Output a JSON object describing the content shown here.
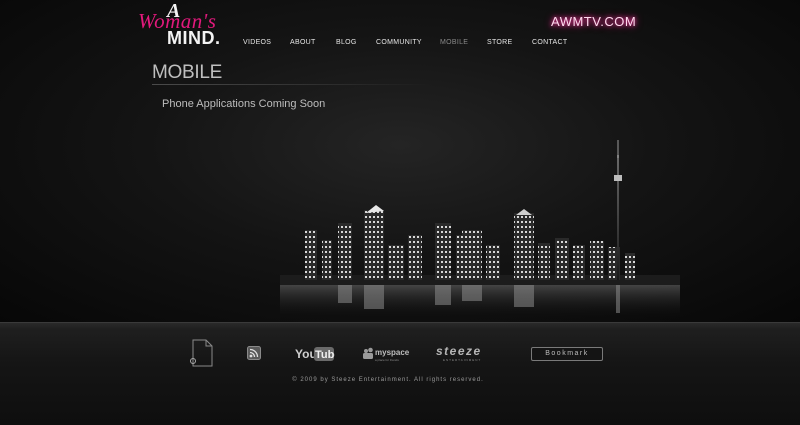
{
  "brand": {
    "logo_a": "A",
    "logo_womans": "Woman's",
    "logo_mind": "MIND.",
    "site_url": "AWMTV.COM",
    "accent_color": "#e2197c"
  },
  "nav": {
    "items": [
      {
        "label": "VIDEOS",
        "active": false
      },
      {
        "label": "ABOUT",
        "active": false
      },
      {
        "label": "BLOG",
        "active": false
      },
      {
        "label": "COMMUNITY",
        "active": false
      },
      {
        "label": "MOBILE",
        "active": true
      },
      {
        "label": "STORE",
        "active": false
      },
      {
        "label": "CONTACT",
        "active": false
      }
    ]
  },
  "main": {
    "title": "MOBILE",
    "text": "Phone Applications Coming Soon"
  },
  "footer": {
    "icons": [
      "document-icon",
      "rss-icon",
      "youtube-logo",
      "myspace-logo",
      "steeze-logo"
    ],
    "youtube_you": "You",
    "youtube_tube": "Tube",
    "myspace_label": "myspace",
    "myspace_tagline": "a place for friends",
    "steeze_label": "steeze",
    "steeze_sub": "ENTERTAINMENT",
    "bookmark_label": "Bookmark",
    "copyright": "© 2009 by Steeze Entertainment. All rights reserved."
  }
}
